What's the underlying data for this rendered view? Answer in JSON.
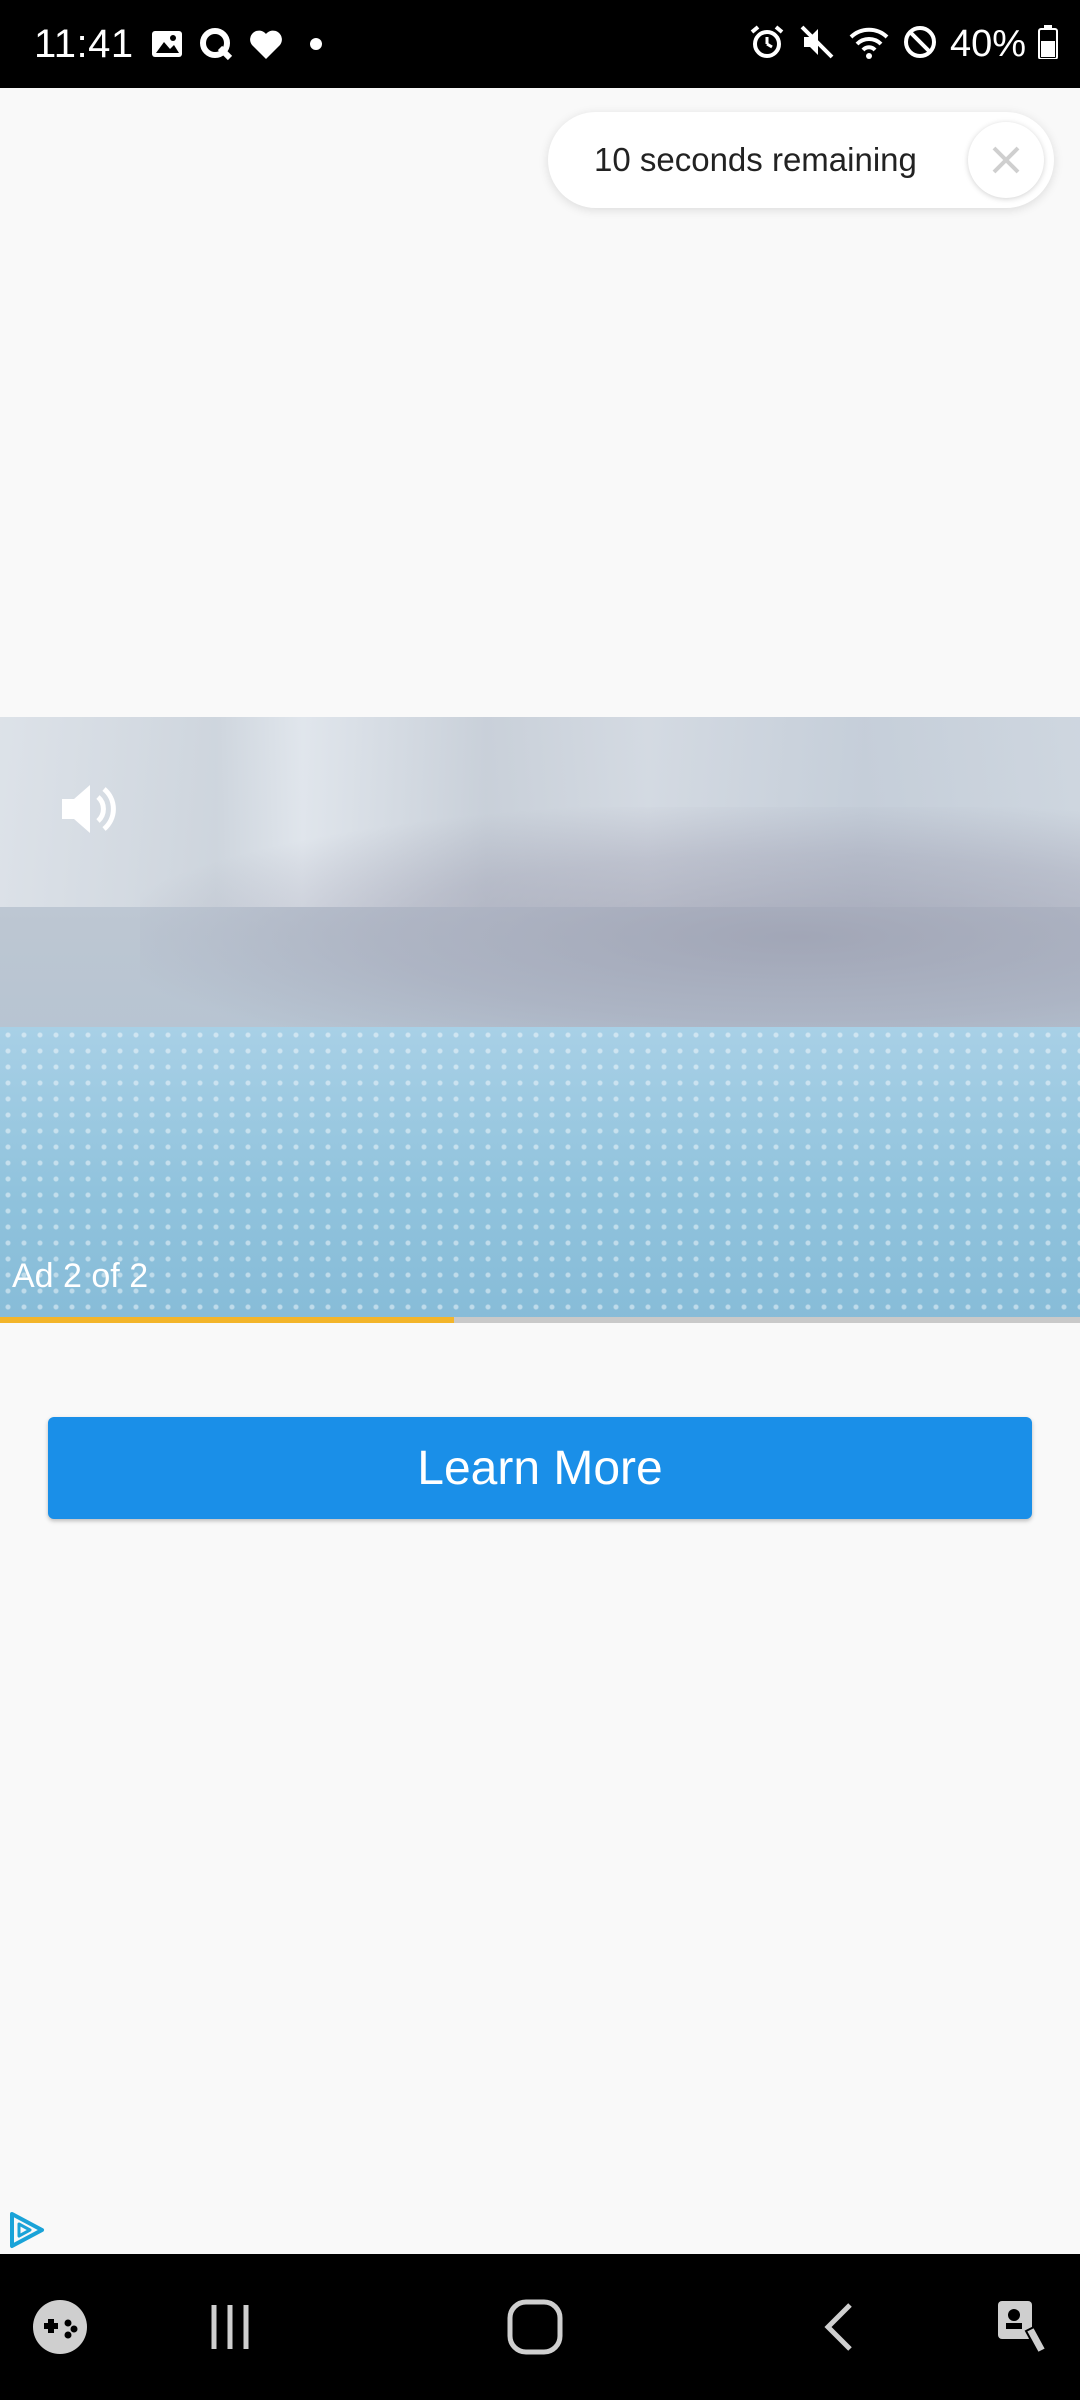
{
  "status_bar": {
    "time": "11:41",
    "battery": "40%",
    "left_icons": [
      "gallery-icon",
      "q-app-icon",
      "heart-icon",
      "dot-icon"
    ],
    "right_icons": [
      "alarm-icon",
      "mute-icon",
      "wifi-icon",
      "do-not-disturb-icon",
      "battery-icon"
    ]
  },
  "countdown": {
    "text": "10 seconds remaining",
    "close_icon": "close-icon"
  },
  "ad": {
    "counter": "Ad 2 of 2",
    "sound_icon": "speaker-icon",
    "progress": 0.42,
    "progress_color": "#f3b52a"
  },
  "cta": {
    "label": "Learn More",
    "color": "#1a8fe8"
  },
  "adchoices_icon": "play-triangle-icon",
  "nav_bar": {
    "items": [
      "game-launcher-icon",
      "recents-icon",
      "home-icon",
      "back-icon",
      "accessibility-icon"
    ]
  }
}
